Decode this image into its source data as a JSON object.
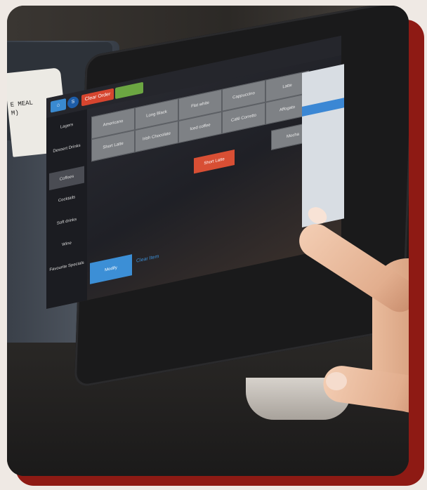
{
  "receipt": {
    "line1": "E MEAL",
    "line2": "M)"
  },
  "app": {
    "topbar": {
      "red_button": "Clear Order",
      "green_button": ""
    },
    "sidebar": [
      {
        "label": "Lagers"
      },
      {
        "label": "Dessert Drinks"
      },
      {
        "label": "Coffees"
      },
      {
        "label": "Cocktails"
      },
      {
        "label": "Soft drinks"
      },
      {
        "label": "Wine"
      },
      {
        "label": "Favourite Specials"
      }
    ],
    "grid": [
      [
        "Americano",
        "Long Black",
        "Flat white",
        "Cappuccino",
        "Latte"
      ],
      [
        "Short Latte",
        "Irish Chocolate",
        "Iced coffee",
        "Café Corretto",
        "Affogato"
      ]
    ],
    "highlight_button": "Short Latte",
    "right_button": "Mocha",
    "bottom_button": "Modify",
    "bottom_link": "Clear Item"
  },
  "colors": {
    "frame": "#8e1a14",
    "accent_red": "#d6452f",
    "accent_blue": "#3c8fd6",
    "accent_green": "#6ca642"
  }
}
